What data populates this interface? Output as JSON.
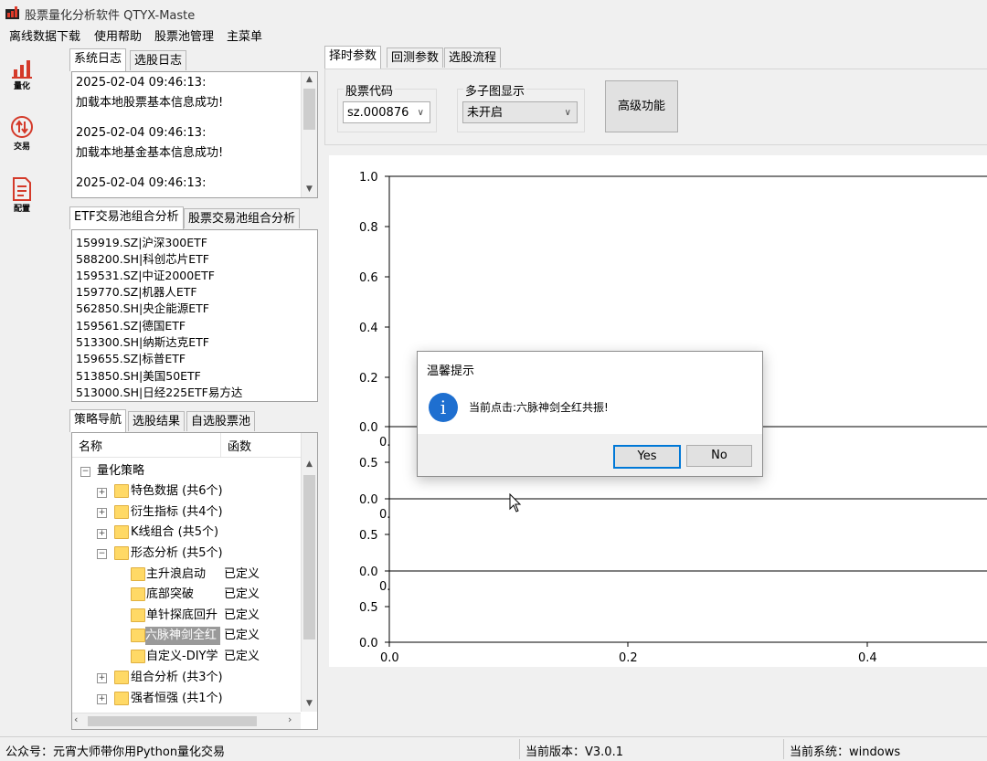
{
  "window": {
    "title": "股票量化分析软件 QTYX-Maste"
  },
  "menu": {
    "items": [
      "离线数据下载",
      "使用帮助",
      "股票池管理",
      "主菜单"
    ]
  },
  "leftnav": {
    "items": [
      {
        "label": "量化",
        "icon": "bar-chart-icon"
      },
      {
        "label": "交易",
        "icon": "trade-arrows-icon"
      },
      {
        "label": "配置",
        "icon": "document-icon"
      }
    ],
    "accent": "#d43a2a"
  },
  "log_tabs": {
    "tabs": [
      "系统日志",
      "选股日志"
    ]
  },
  "log": {
    "lines": [
      "2025-02-04 09:46:13:",
      "加载本地股票基本信息成功!",
      "2025-02-04 09:46:13:",
      "加载本地基金基本信息成功!",
      "2025-02-04 09:46:13:"
    ]
  },
  "pool_tabs": {
    "tabs": [
      "ETF交易池组合分析",
      "股票交易池组合分析"
    ]
  },
  "etf_list": [
    "159919.SZ|沪深300ETF",
    "588200.SH|科创芯片ETF",
    "159531.SZ|中证2000ETF",
    "159770.SZ|机器人ETF",
    "562850.SH|央企能源ETF",
    "159561.SZ|德国ETF",
    "513300.SH|纳斯达克ETF",
    "159655.SZ|标普ETF",
    "513850.SH|美国50ETF",
    "513000.SH|日经225ETF易方达"
  ],
  "strategy_tabs": {
    "tabs": [
      "策略导航",
      "选股结果",
      "自选股票池"
    ]
  },
  "tree": {
    "columns": [
      "名称",
      "函数"
    ],
    "root": "量化策略",
    "groups": [
      {
        "label": "特色数据 (共6个)",
        "expanded": false
      },
      {
        "label": "衍生指标 (共4个)",
        "expanded": false
      },
      {
        "label": "K线组合 (共5个)",
        "expanded": false
      },
      {
        "label": "形态分析 (共5个)",
        "expanded": true
      },
      {
        "label": "组合分析 (共3个)",
        "expanded": false
      },
      {
        "label": "强者恒强 (共1个)",
        "expanded": false
      }
    ],
    "children": [
      {
        "label": "主升浪启动",
        "func": "已定义",
        "selected": false
      },
      {
        "label": "底部突破",
        "func": "已定义",
        "selected": false
      },
      {
        "label": "单针探底回升",
        "func": "已定义",
        "selected": false
      },
      {
        "label": "六脉神剑全红",
        "func": "已定义",
        "selected": true
      },
      {
        "label": "自定义-DIY学",
        "func": "已定义",
        "selected": false
      }
    ]
  },
  "right_tabs": {
    "tabs": [
      "择时参数",
      "回测参数",
      "选股流程"
    ]
  },
  "params": {
    "stock_code_label": "股票代码",
    "stock_code_value": "sz.000876",
    "subplot_label": "多子图显示",
    "subplot_value": "未开启",
    "advanced_label": "高级功能"
  },
  "chart": {
    "top_ticks": [
      "1.0",
      "0.8",
      "0.6",
      "0.4",
      "0.2",
      "0.0"
    ],
    "sub_ticks_a": [
      "0.5",
      "0.0"
    ],
    "sub_ticks_b": [
      "0.5",
      "0.0"
    ],
    "sub_ticks_c": [
      "0.5",
      "0.0"
    ],
    "x_ticks": [
      "0.0",
      "0.2",
      "0.4"
    ],
    "cut_labels": [
      "0.",
      "0.",
      "0."
    ]
  },
  "dialog": {
    "title": "温馨提示",
    "message": "当前点击:六脉神剑全红共振!",
    "yes": "Yes",
    "no": "No",
    "icon_text": "i"
  },
  "status": {
    "left": "公众号：元宵大师带你用Python量化交易",
    "version": "当前版本：V3.0.1",
    "system": "当前系统：windows"
  }
}
